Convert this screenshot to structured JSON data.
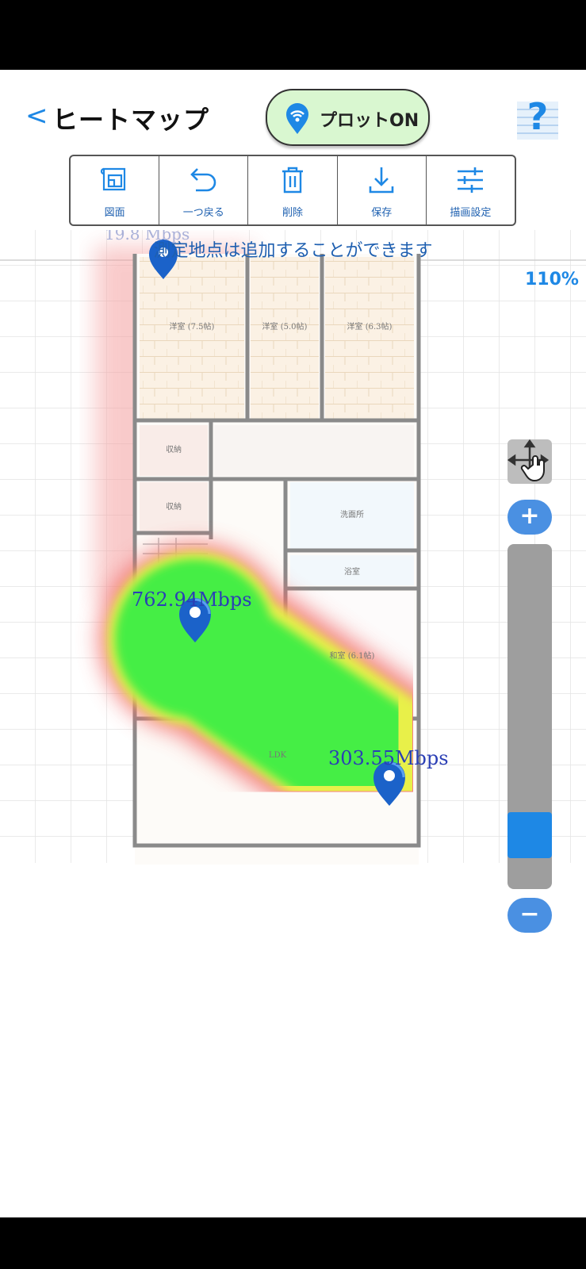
{
  "header": {
    "back_label": "<",
    "title": "ヒートマップ",
    "plot_toggle_label": "プロットON",
    "help_label": "?"
  },
  "toolbar": {
    "items": [
      {
        "label": "図面",
        "icon": "floorplan-icon"
      },
      {
        "label": "一つ戻る",
        "icon": "undo-icon"
      },
      {
        "label": "削除",
        "icon": "trash-icon"
      },
      {
        "label": "保存",
        "icon": "download-icon"
      },
      {
        "label": "描画設定",
        "icon": "sliders-icon"
      }
    ]
  },
  "map": {
    "hint": "測定地点は追加することができます",
    "zoom_level": "110%",
    "top_speed_label": "19.8 Mbps",
    "rooms": [
      "洋室 (7.5帖)",
      "洋室 (5.0帖)",
      "洋室 (6.3帖)",
      "収納",
      "収納",
      "洗面所",
      "浴室",
      "和室 (6.1帖)",
      "LDK"
    ],
    "measurements": [
      {
        "label": "762.94Mbps"
      },
      {
        "label": "303.55Mbps"
      }
    ]
  },
  "zoom_controls": {
    "zoom_in_label": "+",
    "zoom_out_label": "−",
    "slider_fraction": 0.08
  },
  "colors": {
    "accent": "#1e88e5",
    "pill_bg": "#d9f7d0",
    "heat_good": "#3cf03c",
    "heat_bad": "#f05050"
  }
}
